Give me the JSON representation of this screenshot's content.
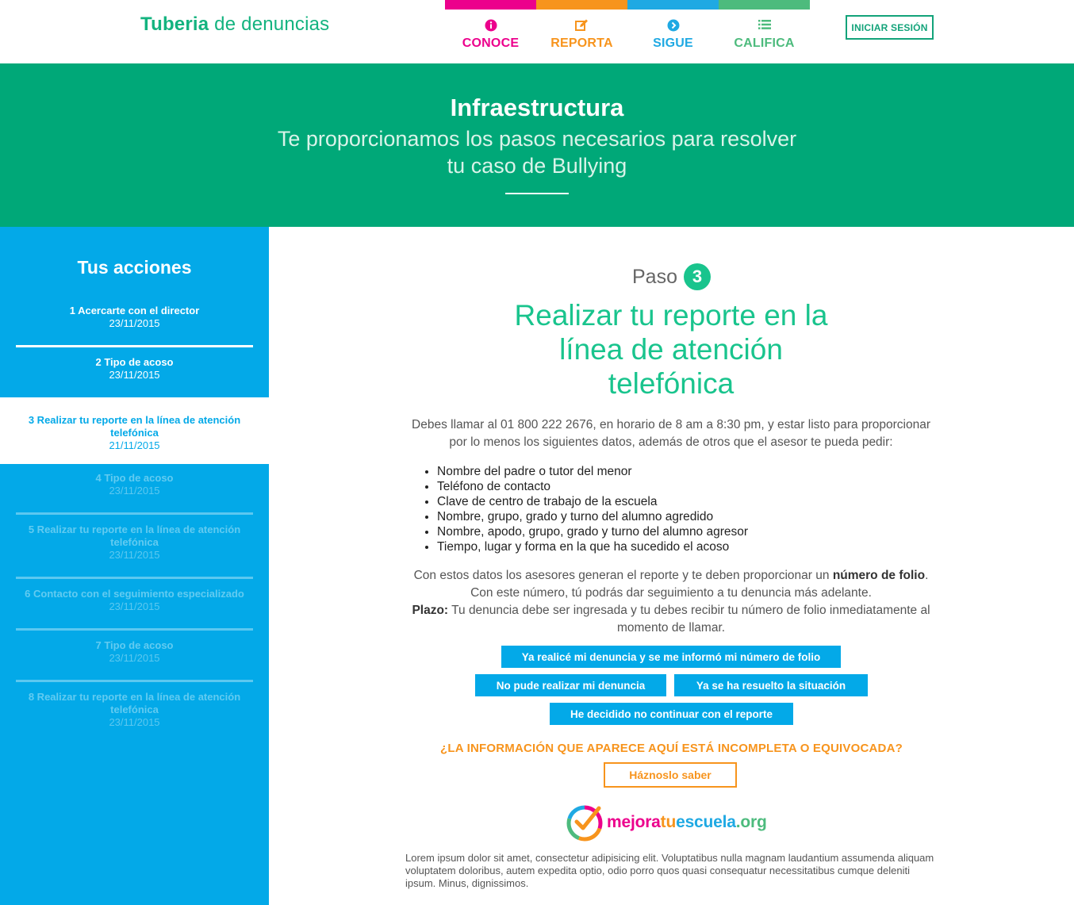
{
  "header": {
    "brand_bold": "Tuberia",
    "brand_rest": " de denuncias",
    "nav": [
      {
        "label": "CONOCE",
        "color": "#ec008c",
        "icon": "info-icon"
      },
      {
        "label": "REPORTA",
        "color": "#f7941d",
        "icon": "edit-icon"
      },
      {
        "label": "SIGUE",
        "color": "#1fa9e3",
        "icon": "chevron-right-icon"
      },
      {
        "label": "CALIFICA",
        "color": "#4dbb7d",
        "icon": "list-icon"
      }
    ],
    "login_label": "INICIAR SESIÓN"
  },
  "hero": {
    "title": "Infraestructura",
    "subtitle": "Te proporcionamos los pasos necesarios para resolver tu caso de Bullying"
  },
  "sidebar": {
    "title": "Tus acciones",
    "actions": [
      {
        "title": "1 Acercarte con el director",
        "date": "23/11/2015",
        "state": "done"
      },
      {
        "title": "2 Tipo de acoso",
        "date": "23/11/2015",
        "state": "done"
      },
      {
        "title": "3 Realizar tu reporte en la línea de atención telefónica",
        "date": "21/11/2015",
        "state": "current"
      },
      {
        "title": "4 Tipo de acoso",
        "date": "23/11/2015",
        "state": "pending"
      },
      {
        "title": "5 Realizar tu reporte en la línea de atención telefónica",
        "date": "23/11/2015",
        "state": "pending"
      },
      {
        "title": "6 Contacto con el seguimiento especializado",
        "date": "23/11/2015",
        "state": "pending"
      },
      {
        "title": "7 Tipo de acoso",
        "date": "23/11/2015",
        "state": "pending"
      },
      {
        "title": "8 Realizar tu reporte en la línea de atención telefónica",
        "date": "23/11/2015",
        "state": "pending"
      }
    ]
  },
  "main": {
    "step_label": "Paso",
    "step_number": "3",
    "step_title": "Realizar tu reporte en la línea de atención telefónica",
    "intro": "Debes llamar al 01 800 222 2676, en horario de 8 am a 8:30 pm, y estar listo para proporcionar por lo menos los siguientes datos, además de otros que el asesor te pueda pedir:",
    "list": [
      "Nombre del padre o tutor del menor",
      "Teléfono de contacto",
      "Clave de centro de trabajo de la escuela",
      "Nombre, grupo, grado y turno del alumno agredido",
      "Nombre, apodo, grupo, grado y turno del alumno agresor",
      "Tiempo, lugar y forma en la que ha sucedido el acoso"
    ],
    "folio_pre": "Con estos datos los asesores generan el reporte y te deben proporcionar un ",
    "folio_bold": "número de folio",
    "folio_post": ". Con este número, tú podrás dar seguimiento a tu denuncia más adelante.",
    "plazo_label": "Plazo:",
    "plazo_text": " Tu denuncia debe ser ingresada y tu debes recibir tu número de folio inmediatamente al momento de llamar.",
    "buttons": {
      "folio": "Ya realicé mi denuncia y se me informó mi número de folio",
      "failed": "No pude realizar mi denuncia",
      "resolved": "Ya se ha resuelto la situación",
      "stop": "He decidido no continuar con el reporte"
    },
    "warning": "¿LA INFORMACIÓN QUE APARECE AQUÍ ESTÁ INCOMPLETA O EQUIVOCADA?",
    "tell_label": "Háznoslo saber",
    "logo": {
      "mejora": "mejora",
      "tu": "tu",
      "escuela": "escuela",
      "org": ".org"
    },
    "lorem": "Lorem ipsum dolor sit amet, consectetur adipisicing elit. Voluptatibus nulla magnam laudantium assumenda aliquam voluptatem doloribus, autem expedita optio, odio porro quos quasi consequatur necessitatibus cumque deleniti ipsum. Minus, dignissimos."
  },
  "colors": {
    "green": "#00a878",
    "accent_green": "#19c48d",
    "blue": "#03a9e8",
    "orange": "#f7941d",
    "pink": "#ec008c"
  }
}
